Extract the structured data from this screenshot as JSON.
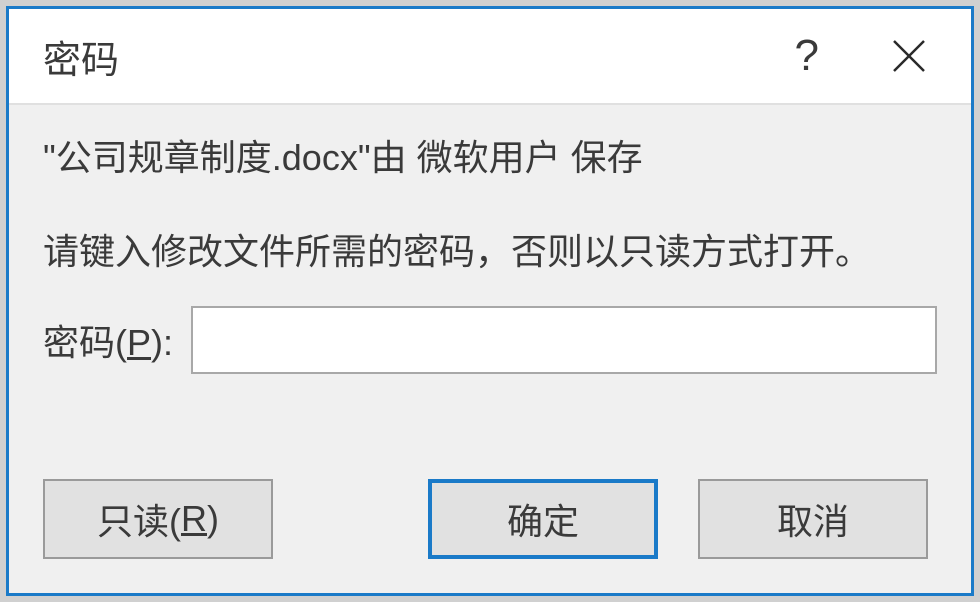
{
  "titlebar": {
    "title": "密码",
    "help": "?",
    "close": "×"
  },
  "body": {
    "file_info": "\"公司规章制度.docx\"由 微软用户 保存",
    "instruction": "请键入修改文件所需的密码，否则以只读方式打开。",
    "password_label_prefix": "密码(",
    "password_label_key": "P",
    "password_label_suffix": "):",
    "password_value": ""
  },
  "buttons": {
    "readonly_prefix": "只读(",
    "readonly_key": "R",
    "readonly_suffix": ")",
    "ok": "确定",
    "cancel": "取消"
  }
}
